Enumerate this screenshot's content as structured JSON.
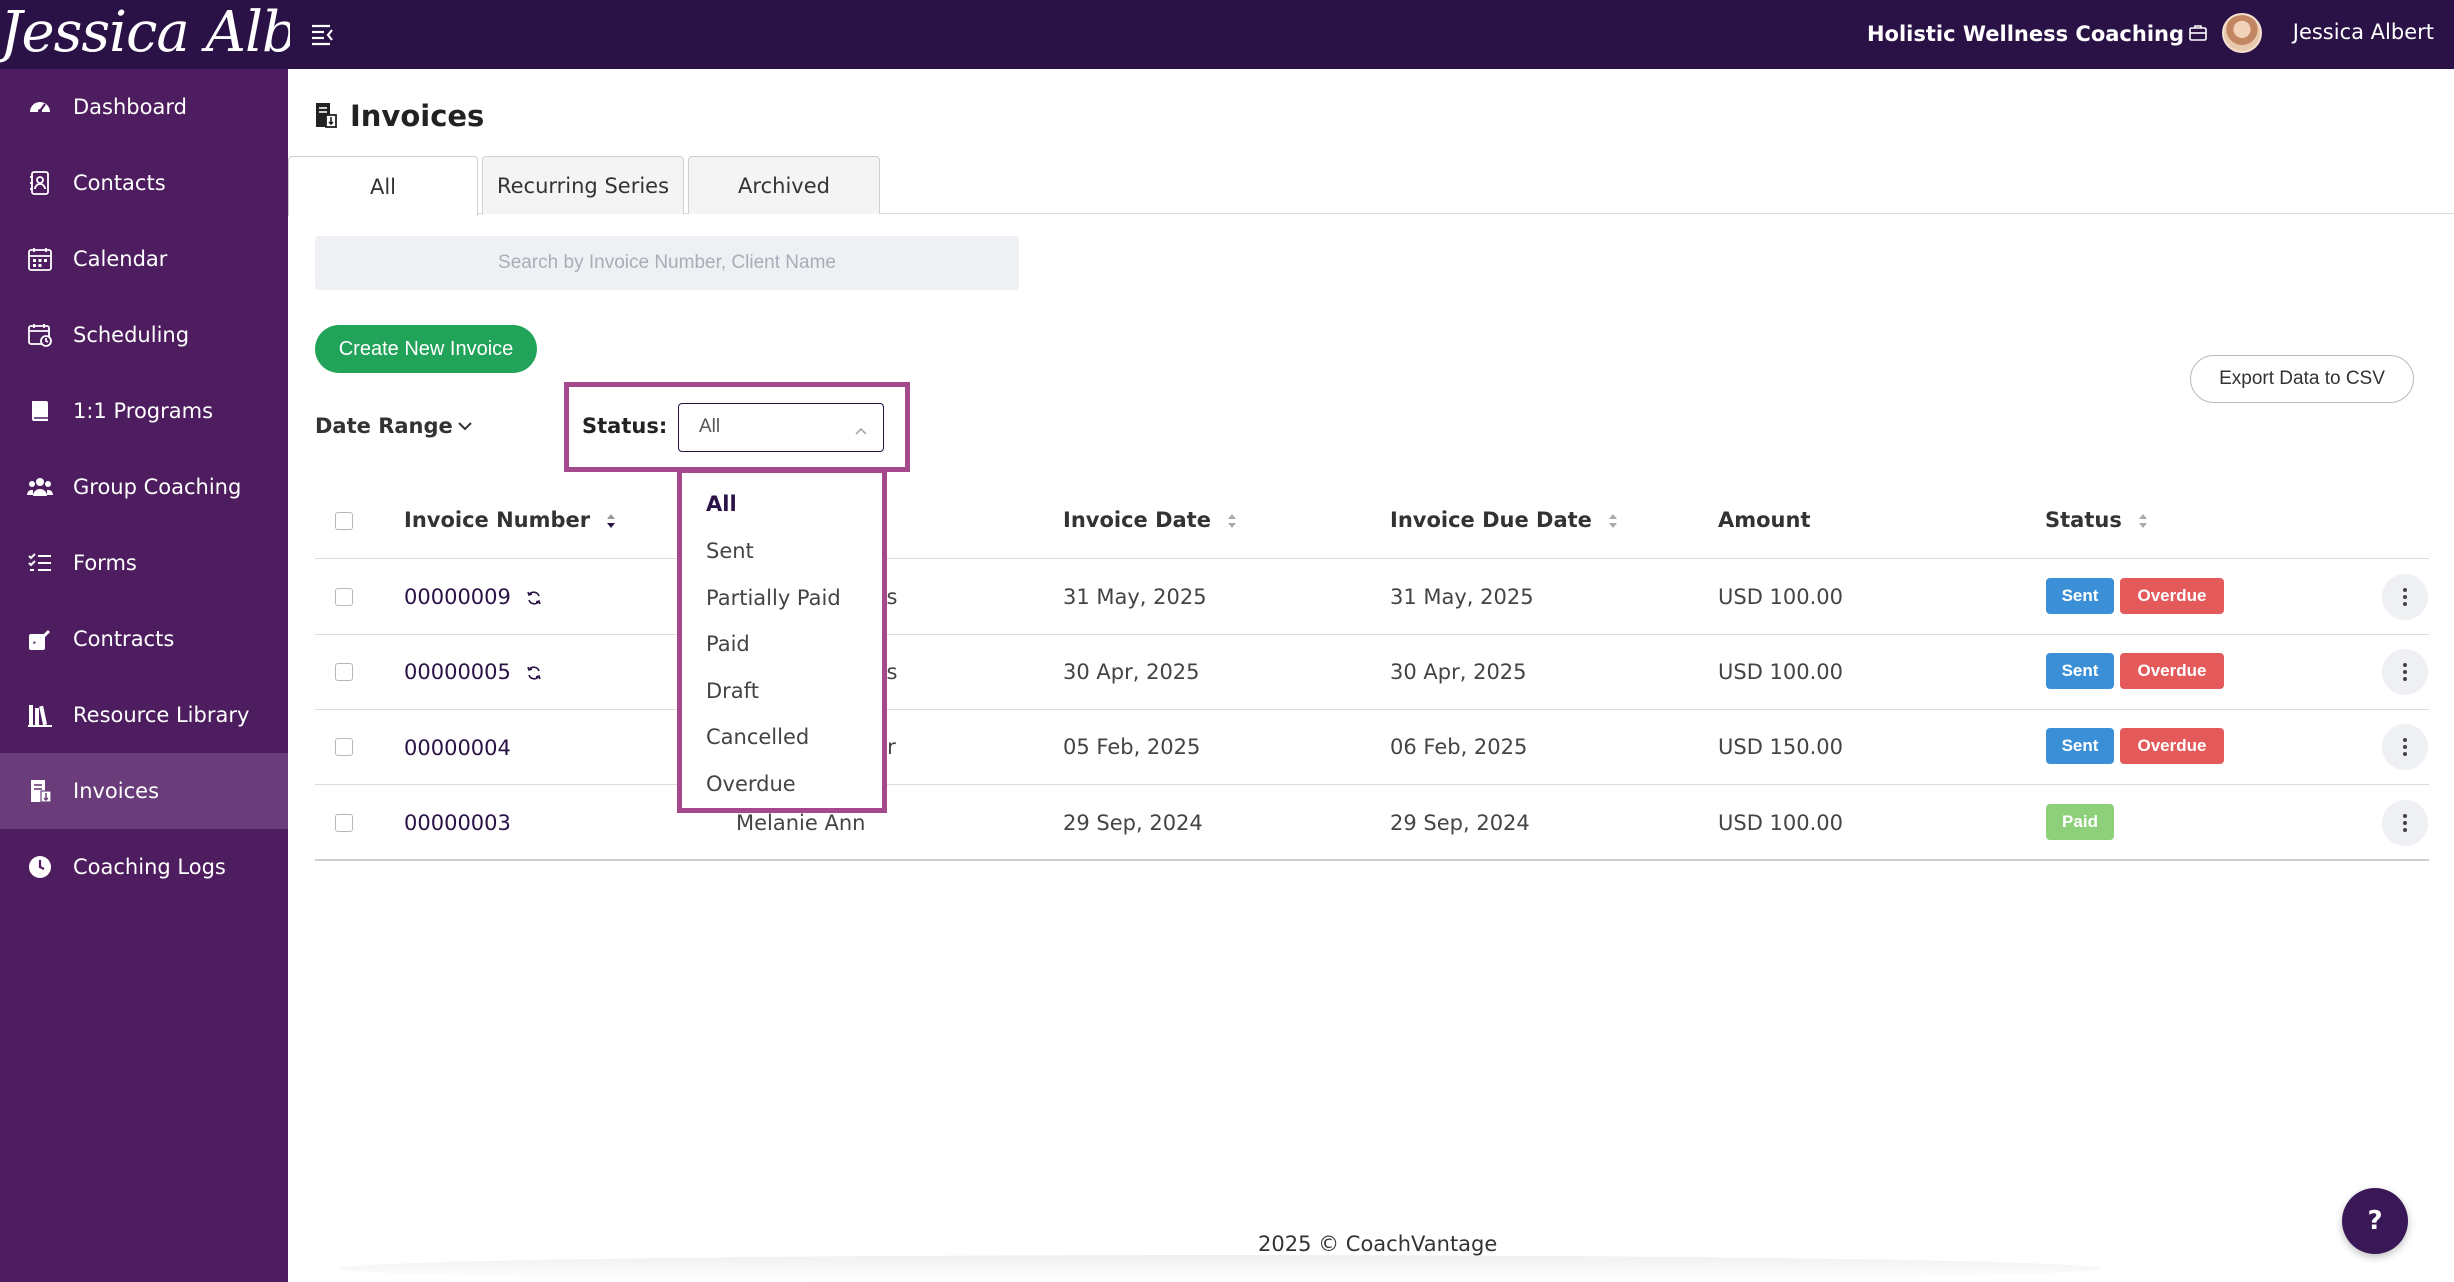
{
  "topbar": {
    "logo_text": "Jessica Albert",
    "business_name": "Holistic Wellness Coaching",
    "user_name": "Jessica Albert"
  },
  "sidebar": {
    "items": [
      {
        "label": "Dashboard",
        "icon": "dashboard-icon"
      },
      {
        "label": "Contacts",
        "icon": "contacts-icon"
      },
      {
        "label": "Calendar",
        "icon": "calendar-icon"
      },
      {
        "label": "Scheduling",
        "icon": "scheduling-icon"
      },
      {
        "label": "1:1 Programs",
        "icon": "book-icon"
      },
      {
        "label": "Group Coaching",
        "icon": "group-icon"
      },
      {
        "label": "Forms",
        "icon": "forms-icon"
      },
      {
        "label": "Contracts",
        "icon": "contract-icon"
      },
      {
        "label": "Resource Library",
        "icon": "library-icon"
      },
      {
        "label": "Invoices",
        "icon": "invoice-icon",
        "active": true
      },
      {
        "label": "Coaching Logs",
        "icon": "clock-icon"
      }
    ]
  },
  "page": {
    "title": "Invoices"
  },
  "tabs": [
    {
      "label": "All",
      "active": true
    },
    {
      "label": "Recurring Series"
    },
    {
      "label": "Archived"
    }
  ],
  "search": {
    "placeholder": "Search by Invoice Number, Client Name",
    "value": ""
  },
  "actions": {
    "create_label": "Create New Invoice",
    "export_label": "Export Data to CSV"
  },
  "filters": {
    "date_range_label": "Date Range",
    "status_label": "Status:",
    "status_value": "All",
    "status_options": [
      "All",
      "Sent",
      "Partially Paid",
      "Paid",
      "Draft",
      "Cancelled",
      "Overdue"
    ]
  },
  "table": {
    "headers": {
      "invoice_number": "Invoice Number",
      "invoice_date": "Invoice Date",
      "due_date": "Invoice Due Date",
      "amount": "Amount",
      "status": "Status"
    },
    "rows": [
      {
        "number": "00000009",
        "recurring": true,
        "client": "ms",
        "invoice_date": "31 May, 2025",
        "due_date": "31 May, 2025",
        "amount": "USD 100.00",
        "badges": [
          "Sent",
          "Overdue"
        ]
      },
      {
        "number": "00000005",
        "recurring": true,
        "client": "ms",
        "invoice_date": "30 Apr, 2025",
        "due_date": "30 Apr, 2025",
        "amount": "USD 100.00",
        "badges": [
          "Sent",
          "Overdue"
        ]
      },
      {
        "number": "00000004",
        "recurring": false,
        "client": "ter",
        "invoice_date": "05 Feb, 2025",
        "due_date": "06 Feb, 2025",
        "amount": "USD 150.00",
        "badges": [
          "Sent",
          "Overdue"
        ]
      },
      {
        "number": "00000003",
        "recurring": false,
        "client": "Melanie Ann",
        "invoice_date": "29 Sep, 2024",
        "due_date": "29 Sep, 2024",
        "amount": "USD 100.00",
        "badges": [
          "Paid"
        ]
      }
    ]
  },
  "footer": {
    "text": "2025 © CoachVantage",
    "help_label": "?"
  },
  "colors": {
    "topbar": "#2a1247",
    "sidebar": "#4e1d5f",
    "accent_green": "#22a35a",
    "highlight": "#a44a8c",
    "sent": "#3a8fd6",
    "overdue": "#e45a5a",
    "paid": "#8ecf7a"
  }
}
